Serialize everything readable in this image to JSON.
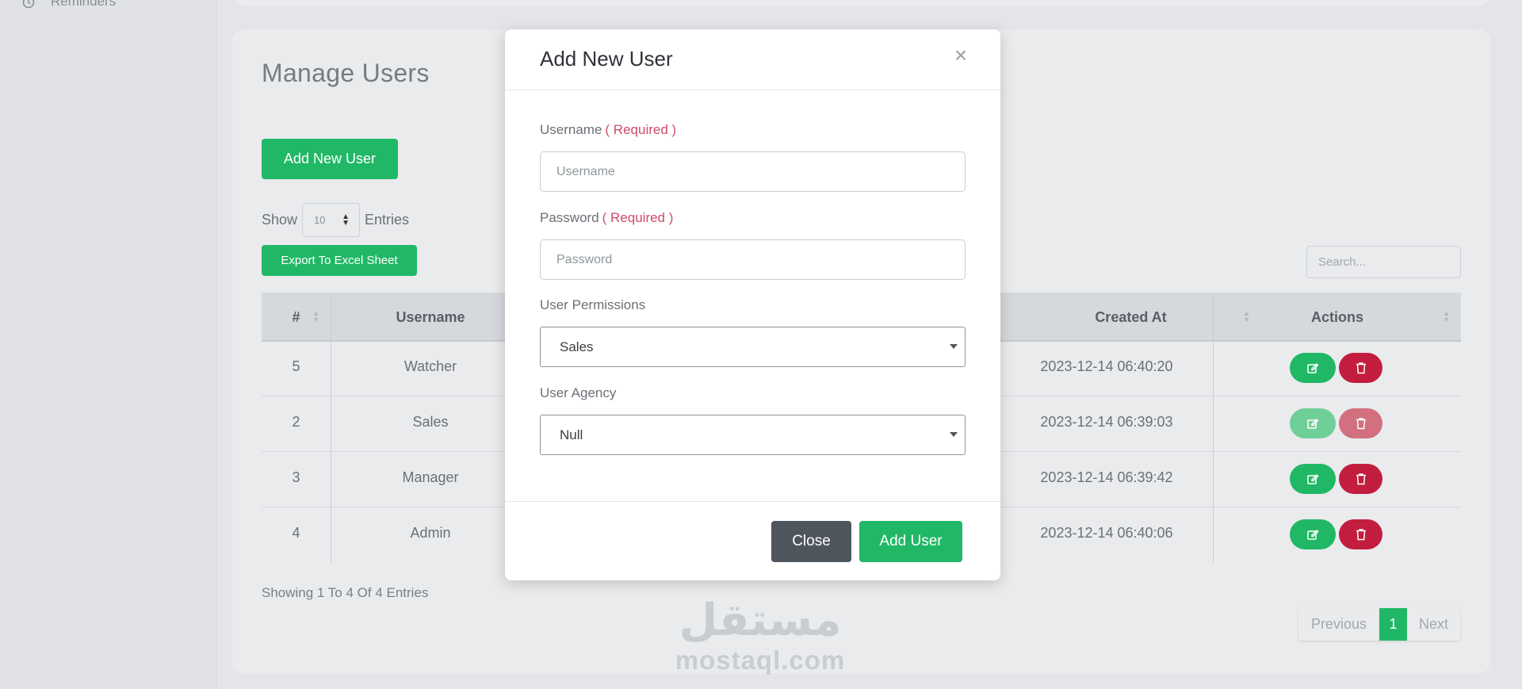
{
  "sidebar": {
    "items": [
      {
        "label": "Reminders",
        "icon": "alarm-clock-icon"
      }
    ]
  },
  "page": {
    "title": "Manage Users",
    "add_button": "Add New User",
    "show_label": "Show",
    "entries_value": "10",
    "entries_label": "Entries",
    "export_button": "Export To Excel Sheet",
    "search_placeholder": "Search..."
  },
  "table": {
    "columns": [
      "#",
      "Username",
      "Created At",
      "Actions"
    ],
    "rows": [
      {
        "id": "5",
        "username": "Watcher",
        "created_at": "2023-12-14 06:40:20"
      },
      {
        "id": "2",
        "username": "Sales",
        "created_at": "2023-12-14 06:39:03"
      },
      {
        "id": "3",
        "username": "Manager",
        "created_at": "2023-12-14 06:39:42"
      },
      {
        "id": "4",
        "username": "Admin",
        "created_at": "2023-12-14 06:40:06"
      }
    ],
    "showing_info": "Showing 1 To 4 Of 4 Entries"
  },
  "pagination": {
    "previous": "Previous",
    "current": "1",
    "next": "Next"
  },
  "watermark": {
    "arabic": "مستقل",
    "latin": "mostaql.com"
  },
  "modal": {
    "title": "Add New User",
    "close_symbol": "×",
    "fields": {
      "username_label": "Username",
      "username_required": "( Required )",
      "username_placeholder": "Username",
      "password_label": "Password",
      "password_required": "( Required )",
      "password_placeholder": "Password",
      "permissions_label": "User Permissions",
      "permissions_value": "Sales",
      "agency_label": "User Agency",
      "agency_value": "Null"
    },
    "close_button": "Close",
    "submit_button": "Add User"
  },
  "colors": {
    "accent_green": "#20b866",
    "danger_red": "#c21d3f",
    "close_gray": "#4f555c",
    "required_pink": "#d04a6a"
  }
}
